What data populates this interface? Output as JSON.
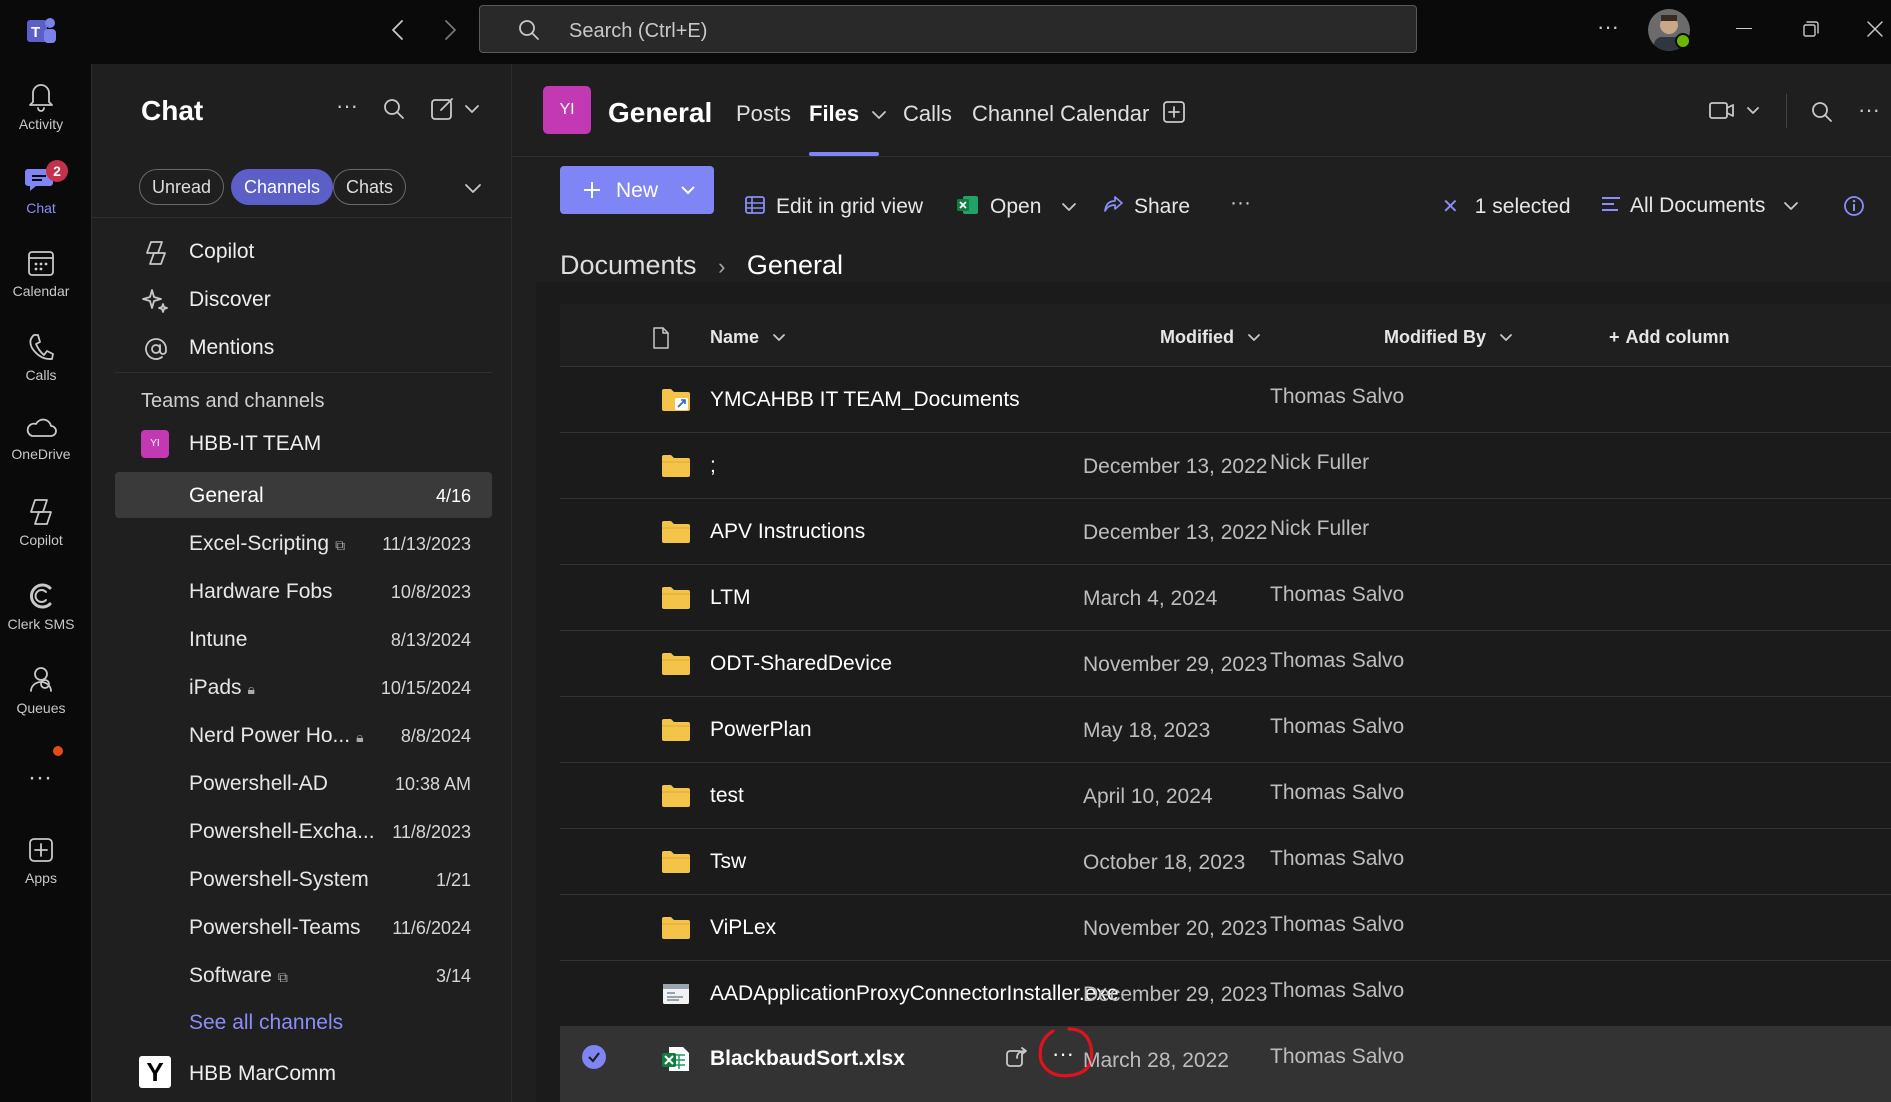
{
  "topbar": {
    "search_placeholder": "Search (Ctrl+E)",
    "more_label": "···"
  },
  "rail": {
    "items": [
      {
        "label": "Activity",
        "icon": "bell-icon"
      },
      {
        "label": "Chat",
        "icon": "chat-icon",
        "badge": "2"
      },
      {
        "label": "Calendar",
        "icon": "calendar-icon"
      },
      {
        "label": "Calls",
        "icon": "phone-icon"
      },
      {
        "label": "OneDrive",
        "icon": "cloud-icon"
      },
      {
        "label": "Copilot",
        "icon": "copilot-icon"
      },
      {
        "label": "Clerk SMS",
        "icon": "clerk-icon"
      },
      {
        "label": "Queues",
        "icon": "queues-icon"
      },
      {
        "label": "Apps",
        "icon": "apps-icon"
      }
    ]
  },
  "chatpane": {
    "title": "Chat",
    "filters": [
      "Unread",
      "Channels",
      "Chats"
    ],
    "nav": [
      "Copilot",
      "Discover",
      "Mentions"
    ],
    "section_label": "Teams and channels",
    "team_name": "HBB-IT TEAM",
    "team_avatar": "YI",
    "channels": [
      {
        "name": "General",
        "date": "4/16"
      },
      {
        "name": "Excel-Scripting",
        "date": "11/13/2023"
      },
      {
        "name": "Hardware Fobs",
        "date": "10/8/2023"
      },
      {
        "name": "Intune",
        "date": "8/13/2024"
      },
      {
        "name": "iPads",
        "date": "10/15/2024"
      },
      {
        "name": "Nerd Power Ho...",
        "date": "8/8/2024"
      },
      {
        "name": "Powershell-AD",
        "date": "10:38 AM"
      },
      {
        "name": "Powershell-Excha...",
        "date": "11/8/2023"
      },
      {
        "name": "Powershell-System",
        "date": "1/21"
      },
      {
        "name": "Powershell-Teams",
        "date": "11/6/2024"
      },
      {
        "name": "Software",
        "date": "3/14"
      }
    ],
    "see_all": "See all channels",
    "other_team": "HBB MarComm",
    "other_team_avatar": "Y"
  },
  "channel_header": {
    "avatar": "YI",
    "name": "General",
    "tabs": [
      "Posts",
      "Files",
      "Calls",
      "Channel Calendar"
    ],
    "active_tab": "Files"
  },
  "toolbar": {
    "new": "New",
    "edit_grid": "Edit in grid view",
    "open": "Open",
    "share": "Share",
    "more": "···",
    "selected": "1 selected",
    "view": "All Documents"
  },
  "breadcrumb": {
    "root": "Documents",
    "current": "General"
  },
  "table": {
    "headers": {
      "name": "Name",
      "modified": "Modified",
      "modified_by": "Modified By",
      "add_column": "Add column"
    },
    "rows": [
      {
        "name": "YMCAHBB IT TEAM_Documents",
        "modified": "",
        "by": "Thomas Salvo",
        "type": "folder-link"
      },
      {
        "name": ";",
        "modified": "December 13, 2022",
        "by": "Nick Fuller",
        "type": "folder"
      },
      {
        "name": "APV Instructions",
        "modified": "December 13, 2022",
        "by": "Nick Fuller",
        "type": "folder"
      },
      {
        "name": "LTM",
        "modified": "March 4, 2024",
        "by": "Thomas Salvo",
        "type": "folder"
      },
      {
        "name": "ODT-SharedDevice",
        "modified": "November 29, 2023",
        "by": "Thomas Salvo",
        "type": "folder"
      },
      {
        "name": "PowerPlan",
        "modified": "May 18, 2023",
        "by": "Thomas Salvo",
        "type": "folder"
      },
      {
        "name": "test",
        "modified": "April 10, 2024",
        "by": "Thomas Salvo",
        "type": "folder"
      },
      {
        "name": "Tsw",
        "modified": "October 18, 2023",
        "by": "Thomas Salvo",
        "type": "folder"
      },
      {
        "name": "ViPLex",
        "modified": "November 20, 2023",
        "by": "Thomas Salvo",
        "type": "folder"
      },
      {
        "name": "AADApplicationProxyConnectorInstaller.exe",
        "modified": "December 29, 2023",
        "by": "Thomas Salvo",
        "type": "exe"
      },
      {
        "name": "BlackbaudSort.xlsx",
        "modified": "March 28, 2022",
        "by": "Thomas Salvo",
        "type": "xlsx",
        "selected": true
      }
    ]
  },
  "colors": {
    "accent": "#7f85f5",
    "folder": "#f3c34a",
    "excel": "#1d9c5a",
    "annotation": "#e0121e",
    "team_avatar": "#c239b3"
  }
}
